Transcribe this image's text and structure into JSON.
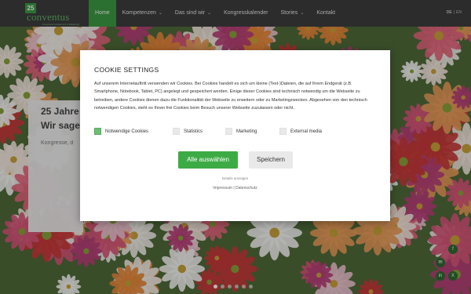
{
  "logo": {
    "badge": "25",
    "name": "conventus",
    "tagline": "Kongressmanagement & Marketing"
  },
  "nav": {
    "items": [
      {
        "label": "Home",
        "active": true,
        "dropdown": false
      },
      {
        "label": "Kompetenzen",
        "active": false,
        "dropdown": true
      },
      {
        "label": "Das sind wir",
        "active": false,
        "dropdown": true
      },
      {
        "label": "Kongresskalender",
        "active": false,
        "dropdown": false
      },
      {
        "label": "Stories",
        "active": false,
        "dropdown": true
      },
      {
        "label": "Kontakt",
        "active": false,
        "dropdown": false
      }
    ],
    "lang": {
      "current": "DE",
      "sep": "|",
      "other": "EN"
    }
  },
  "hero": {
    "title_line1": "25 Jahre",
    "title_line2": "Wir sagen",
    "subtitle": "Kongresse, d"
  },
  "cookie": {
    "title": "COOKIE SETTINGS",
    "body": "Auf unserem Internetauftritt verwenden wir Cookies. Bei Cookies handelt es sich um kleine (Text-)Dateien, die auf Ihrem Endgerät (z.B. Smartphone, Notebook, Tablet, PC) angelegt und gespeichert werden. Einige dieser Cookies sind technisch notwendig um die Webseite zu betreiben, andere Cookies dienen dazu die Funktionalität der Webseite zu erweitern oder zu Marketingzwecken. Abgesehen von den technisch notwendigen Cookies, steht es Ihnen frei Cookies beim Besuch unserer Webseite zuzulassen oder nicht.",
    "options": [
      {
        "label": "Notwendige Cookies",
        "checked": true
      },
      {
        "label": "Statistics",
        "checked": false
      },
      {
        "label": "Marketing",
        "checked": false
      },
      {
        "label": "External media",
        "checked": false
      }
    ],
    "accept_label": "Alle auswählen",
    "save_label": "Speichern",
    "details_label": "Details anzeigen",
    "impressum_label": "Impressum",
    "link_sep": "|",
    "datenschutz_label": "Datenschutz"
  },
  "social": [
    {
      "icon": "mail-icon",
      "glyph": "✉"
    },
    {
      "icon": "facebook-icon",
      "glyph": "f"
    },
    {
      "icon": "linkedin-icon",
      "glyph": "in"
    },
    {
      "icon": "xing-icon",
      "glyph": "X"
    }
  ],
  "slider": {
    "slides": 6,
    "current": 1
  },
  "colors": {
    "brand_green": "#3dab45",
    "nav_bg": "#3d3d3d"
  }
}
